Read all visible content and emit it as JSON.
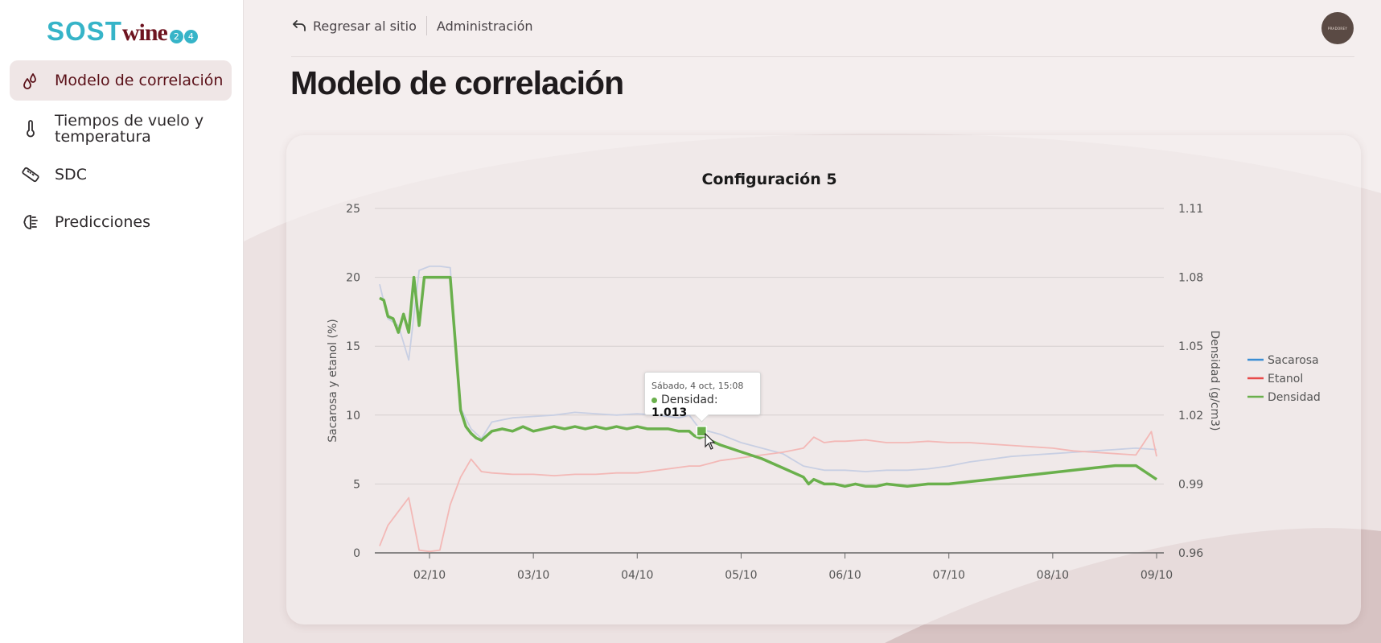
{
  "app": {
    "logo_text_1": "SOST",
    "logo_text_2": "wine",
    "logo_badge": [
      "2",
      "4"
    ]
  },
  "sidebar": {
    "items": [
      {
        "label": "Modelo de correlación",
        "icon": "droplets-icon",
        "active": true
      },
      {
        "label": "Tiempos de vuelo y temperatura",
        "icon": "thermometer-icon",
        "active": false
      },
      {
        "label": "SDC",
        "icon": "ruler-icon",
        "active": false
      },
      {
        "label": "Predicciones",
        "icon": "brain-icon",
        "active": false
      }
    ]
  },
  "topbar": {
    "back_label": "Regresar al sitio",
    "admin_label": "Administración",
    "avatar_text": "PRADOREY"
  },
  "page": {
    "title": "Modelo de correlación"
  },
  "tooltip": {
    "date": "Sábado, 4 oct, 15:08",
    "series": "Densidad",
    "value": "1.013"
  },
  "colors": {
    "sacarosa": "#3b8ed4",
    "etanol": "#e84a4a",
    "densidad": "#6ab04c",
    "accent": "#5a1018"
  },
  "chart_data": {
    "type": "line",
    "title": "Configuración 5",
    "ylabel": "Sacarosa y etanol (%)",
    "y2label": "Densidad (g/cm3)",
    "xlabel": "",
    "ylim": [
      0,
      25
    ],
    "y2lim": [
      0.96,
      1.11
    ],
    "yticks": [
      "0",
      "5",
      "10",
      "15",
      "20",
      "25"
    ],
    "y2ticks": [
      "0.96",
      "0.99",
      "1.02",
      "1.05",
      "1.08",
      "1.11"
    ],
    "xticks": [
      "02/10",
      "03/10",
      "04/10",
      "05/10",
      "06/10",
      "07/10",
      "08/10",
      "09/10"
    ],
    "legend_position": "right",
    "grid": true,
    "series": [
      {
        "name": "Sacarosa",
        "axis": "left",
        "x": [
          1.52,
          1.6,
          1.7,
          1.8,
          1.9,
          2.0,
          2.1,
          2.2,
          2.3,
          2.4,
          2.5,
          2.6,
          2.8,
          3.0,
          3.2,
          3.4,
          3.6,
          3.8,
          4.0,
          4.2,
          4.4,
          4.5,
          4.6,
          4.8,
          5.0,
          5.2,
          5.4,
          5.6,
          5.8,
          6.0,
          6.2,
          6.4,
          6.6,
          6.8,
          7.0,
          7.2,
          7.4,
          7.6,
          7.8,
          8.0,
          8.2,
          8.4,
          8.6,
          8.8,
          9.0
        ],
        "y": [
          19.5,
          17.0,
          16.5,
          14.0,
          20.5,
          20.8,
          20.8,
          20.7,
          10.5,
          9.0,
          8.3,
          9.5,
          9.8,
          9.9,
          10.0,
          10.2,
          10.1,
          10.0,
          10.1,
          10.0,
          9.8,
          10.0,
          9.0,
          8.6,
          8.0,
          7.6,
          7.2,
          6.3,
          6.0,
          6.0,
          5.9,
          6.0,
          6.0,
          6.1,
          6.3,
          6.6,
          6.8,
          7.0,
          7.1,
          7.2,
          7.3,
          7.4,
          7.5,
          7.6,
          7.5
        ]
      },
      {
        "name": "Etanol",
        "axis": "left",
        "x": [
          1.52,
          1.6,
          1.7,
          1.8,
          1.9,
          2.0,
          2.1,
          2.2,
          2.3,
          2.4,
          2.5,
          2.6,
          2.8,
          3.0,
          3.2,
          3.4,
          3.6,
          3.8,
          4.0,
          4.2,
          4.4,
          4.5,
          4.6,
          4.8,
          5.0,
          5.2,
          5.4,
          5.6,
          5.7,
          5.8,
          5.9,
          6.0,
          6.2,
          6.4,
          6.6,
          6.8,
          7.0,
          7.2,
          7.4,
          7.6,
          7.8,
          8.0,
          8.2,
          8.4,
          8.6,
          8.8,
          8.95,
          9.0
        ],
        "y": [
          0.5,
          2.0,
          3.0,
          4.0,
          0.2,
          0.1,
          0.2,
          3.5,
          5.5,
          6.8,
          5.9,
          5.8,
          5.7,
          5.7,
          5.6,
          5.7,
          5.7,
          5.8,
          5.8,
          6.0,
          6.2,
          6.3,
          6.3,
          6.7,
          6.9,
          7.1,
          7.3,
          7.6,
          8.4,
          8.0,
          8.1,
          8.1,
          8.2,
          8.0,
          8.0,
          8.1,
          8.0,
          8.0,
          7.9,
          7.8,
          7.7,
          7.6,
          7.4,
          7.3,
          7.2,
          7.1,
          8.8,
          7.0
        ]
      },
      {
        "name": "Densidad",
        "axis": "right",
        "x": [
          1.52,
          1.56,
          1.6,
          1.65,
          1.7,
          1.75,
          1.8,
          1.85,
          1.9,
          1.95,
          2.0,
          2.1,
          2.2,
          2.3,
          2.35,
          2.4,
          2.45,
          2.5,
          2.6,
          2.7,
          2.8,
          2.9,
          3.0,
          3.1,
          3.2,
          3.3,
          3.4,
          3.5,
          3.6,
          3.7,
          3.8,
          3.9,
          4.0,
          4.1,
          4.2,
          4.3,
          4.4,
          4.5,
          4.55,
          4.6,
          4.65,
          4.7,
          4.8,
          5.0,
          5.2,
          5.4,
          5.6,
          5.65,
          5.7,
          5.75,
          5.8,
          5.9,
          6.0,
          6.1,
          6.2,
          6.3,
          6.4,
          6.6,
          6.8,
          7.0,
          7.2,
          7.4,
          7.6,
          7.8,
          8.0,
          8.2,
          8.4,
          8.6,
          8.8,
          9.0
        ],
        "y": [
          1.071,
          1.07,
          1.063,
          1.062,
          1.056,
          1.064,
          1.056,
          1.08,
          1.059,
          1.08,
          1.08,
          1.08,
          1.08,
          1.022,
          1.015,
          1.012,
          1.01,
          1.009,
          1.013,
          1.014,
          1.013,
          1.015,
          1.013,
          1.014,
          1.015,
          1.014,
          1.015,
          1.014,
          1.015,
          1.014,
          1.015,
          1.014,
          1.015,
          1.014,
          1.014,
          1.014,
          1.013,
          1.013,
          1.011,
          1.01,
          1.011,
          1.009,
          1.007,
          1.004,
          1.001,
          0.997,
          0.993,
          0.99,
          0.992,
          0.991,
          0.99,
          0.99,
          0.989,
          0.99,
          0.989,
          0.989,
          0.99,
          0.989,
          0.99,
          0.99,
          0.991,
          0.992,
          0.993,
          0.994,
          0.995,
          0.996,
          0.997,
          0.998,
          0.998,
          0.992
        ]
      }
    ]
  }
}
